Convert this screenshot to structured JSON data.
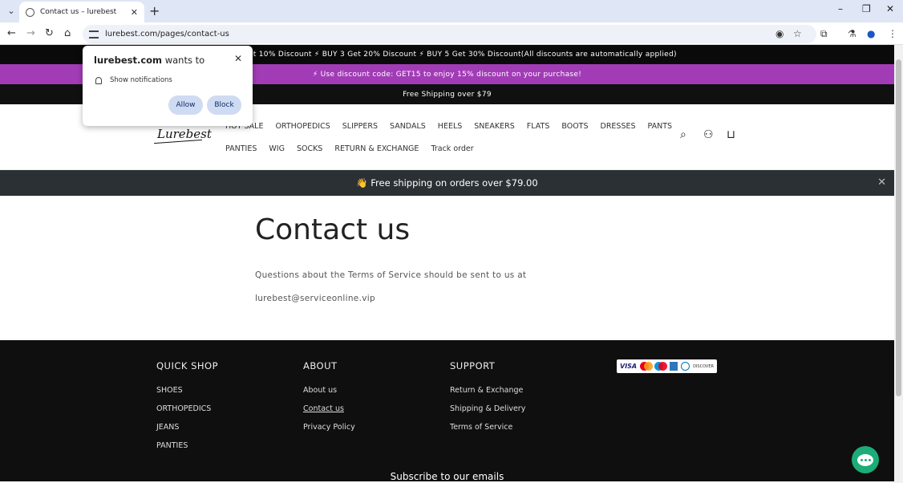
{
  "browser": {
    "tab_title": "Contact us – lurebest",
    "url": "lurebest.com/pages/contact-us",
    "new_tab": "+",
    "minimize": "–",
    "maximize": "❐",
    "close": "✕"
  },
  "announcements": {
    "bar1": "BUY 2 Get 10% Discount  ⚡  BUY 3 Get 20% Discount  ⚡  BUY 5 Get 30% Discount(All discounts are automatically applied)",
    "bar2": "⚡ Use discount code: GET15 to enjoy 15% discount on your purchase!",
    "bar3": "Free Shipping over $79"
  },
  "header": {
    "logo": "Lurebest",
    "nav_row1": [
      "HOT SALE",
      "ORTHOPEDICS",
      "SLIPPERS",
      "SANDALS",
      "HEELS",
      "SNEAKERS",
      "FLATS",
      "BOOTS",
      "DRESSES",
      "PANTS"
    ],
    "nav_row2": [
      "PANTIES",
      "WIG",
      "SOCKS",
      "RETURN & EXCHANGE",
      "Track order"
    ]
  },
  "shipping_banner": {
    "text": "👋 Free shipping on orders over $79.00"
  },
  "main": {
    "title": "Contact us",
    "line1": "Questions about the Terms of Service should be sent to us at",
    "line2": "lurebest@serviceonline.vip"
  },
  "footer": {
    "quick_shop": {
      "heading": "QUICK SHOP",
      "links": [
        "SHOES",
        "ORTHOPEDICS",
        "JEANS",
        "PANTIES"
      ]
    },
    "about": {
      "heading": "ABOUT",
      "links": [
        "About us",
        "Contact us",
        "Privacy Policy"
      ]
    },
    "support": {
      "heading": "SUPPORT",
      "links": [
        "Return & Exchange",
        "Shipping & Delivery",
        "Terms of Service"
      ]
    },
    "payments": {
      "visa": "VISA",
      "discover": "DISCOVER"
    },
    "subscribe": "Subscribe to our emails"
  },
  "popup": {
    "site": "lurebest.com",
    "wants": " wants to",
    "permission": "Show notifications",
    "allow": "Allow",
    "block": "Block"
  }
}
